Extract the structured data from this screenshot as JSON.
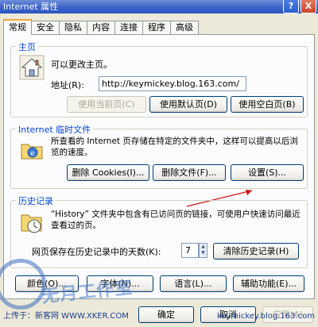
{
  "window": {
    "title": "Internet 属性"
  },
  "title_buttons": {
    "help": "?",
    "close": "X"
  },
  "tabs": [
    "常规",
    "安全",
    "隐私",
    "内容",
    "连接",
    "程序",
    "高级"
  ],
  "home": {
    "group_title": "主页",
    "description": "可以更改主页。",
    "address_label": "地址(R):",
    "address_value": "http://keymickey.blog.163.com/",
    "buttons": [
      "使用当前页(C)",
      "使用默认页(D)",
      "使用空白页(B)"
    ]
  },
  "temp_files": {
    "group_title": "Internet 临时文件",
    "description": "所查看的 Internet 页存储在特定的文件夹中，这样可以提高以后浏览的速度。",
    "buttons": [
      "删除 Cookies(I)...",
      "删除文件(F)...",
      "设置(S)..."
    ]
  },
  "history": {
    "group_title": "历史记录",
    "description": "“History” 文件夹中包含有已访问页的链接，可使用户快速访问最近查看过的页。",
    "days_label": "网页保存在历史记录中的天数(K):",
    "days_value": "7",
    "clear_button": "清除历史记录(H)"
  },
  "bottom_buttons": [
    "颜色(O)...",
    "字体(N)...",
    "语言(L)...",
    "辅助功能(E)..."
  ],
  "footer": {
    "ok": "确定",
    "cancel": "取消",
    "apply": "应用(A)"
  },
  "watermark": {
    "text": "无月工作室",
    "upload": "上传于：新客网 WWW.XKER.COM",
    "site": "keymickey.blog.163.com"
  }
}
